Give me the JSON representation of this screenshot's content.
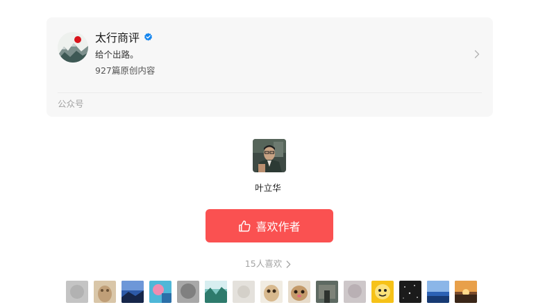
{
  "account": {
    "name": "太行商评",
    "description": "给个出路。",
    "article_count": "927篇原创内容",
    "type_label": "公众号",
    "avatar_icon": "mountain-sun-avatar",
    "verified_icon": "verified-badge-icon",
    "verified_color": "#1485ee"
  },
  "author": {
    "name": "叶立华"
  },
  "like_button": {
    "label": "喜欢作者",
    "icon": "thumbs-up-icon",
    "color": "#fa5151"
  },
  "likers": {
    "label": "15人喜欢",
    "count": 15
  }
}
